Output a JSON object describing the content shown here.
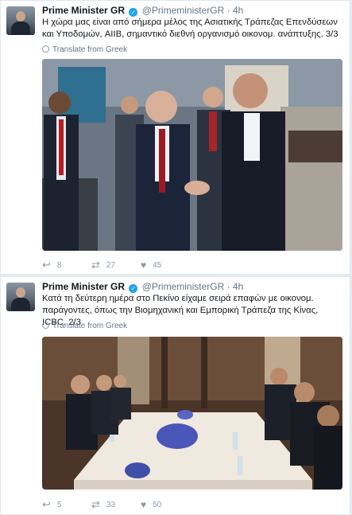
{
  "tweets": [
    {
      "name": "Prime Minister GR",
      "verified_mark": "✓",
      "handle": "@PrimeministerGR",
      "dot": "·",
      "time": "4h",
      "text": "Η χώρα μας είναι από σήμερα μέλος της Ασιατικής Τράπεζας Επενδύσεων και Υποδομών, AIIB, σημαντικό διεθνή οργανισμό οικονομ. ανάπτυξης. 3/3",
      "translate_label": "Translate from Greek",
      "replies": "8",
      "retweets": "27",
      "likes": "45"
    },
    {
      "name": "Prime Minister GR",
      "verified_mark": "✓",
      "handle": "@PrimeministerGR",
      "dot": "·",
      "time": "4h",
      "text": "Κατά τη δεύτερη ημέρα στο Πεκίνο είχαμε σειρά επαφών με οικονομ. παράγοντες, όπως την Βιομηχανική και Εμπορική Τράπεζα της Κίνας, ICBC. 2/3",
      "translate_label": "Translate from Greek",
      "replies": "5",
      "retweets": "33",
      "likes": "50"
    }
  ],
  "icons": {
    "avatar": "avatar-image",
    "verified": "verified-badge-icon",
    "globe": "globe-icon",
    "reply": "reply-icon",
    "retweet": "retweet-icon",
    "like": "heart-icon"
  },
  "colors": {
    "background": "#e6ecf0",
    "card": "#ffffff",
    "muted": "#657786",
    "verified": "#1da1f2"
  }
}
